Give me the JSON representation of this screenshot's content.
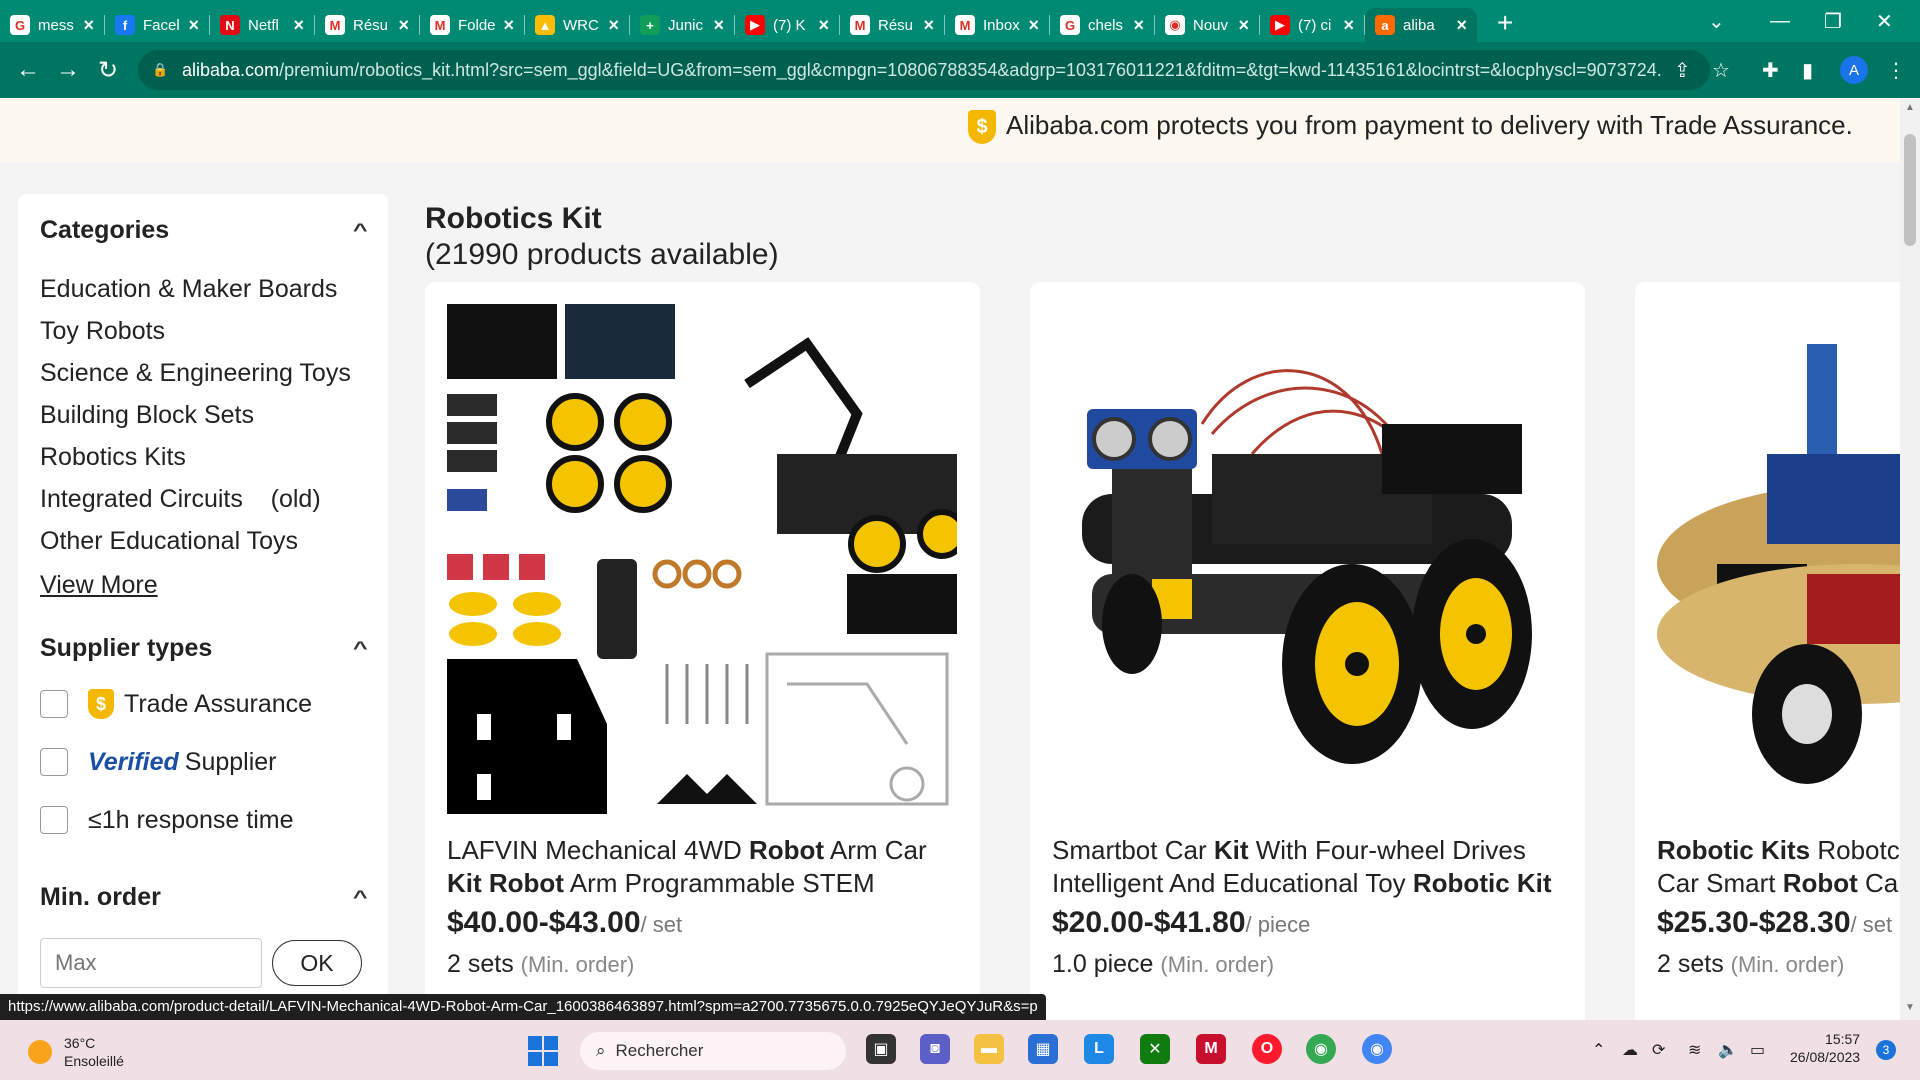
{
  "browser": {
    "tabs": [
      {
        "title": "mess",
        "icon": "google-icon",
        "color": "#ffffff",
        "glyph": "G"
      },
      {
        "title": "Facel",
        "icon": "facebook-icon",
        "color": "#1877f2",
        "glyph": "f"
      },
      {
        "title": "Netfl",
        "icon": "netflix-icon",
        "color": "#e50914",
        "glyph": "N"
      },
      {
        "title": "Résu",
        "icon": "gmail-icon",
        "color": "#ffffff",
        "glyph": "M"
      },
      {
        "title": "Folde",
        "icon": "gmail-icon",
        "color": "#ffffff",
        "glyph": "M"
      },
      {
        "title": "WRC",
        "icon": "drive-icon",
        "color": "#fbbc04",
        "glyph": "▲"
      },
      {
        "title": "Junic",
        "icon": "sheets-icon",
        "color": "#0f9d58",
        "glyph": "+"
      },
      {
        "title": "(7) K",
        "icon": "youtube-icon",
        "color": "#ff0000",
        "glyph": "▶"
      },
      {
        "title": "Résu",
        "icon": "gmail-icon",
        "color": "#ffffff",
        "glyph": "M"
      },
      {
        "title": "Inbox",
        "icon": "gmail-icon",
        "color": "#ffffff",
        "glyph": "M"
      },
      {
        "title": "chels",
        "icon": "google-icon",
        "color": "#ffffff",
        "glyph": "G"
      },
      {
        "title": "Nouv",
        "icon": "chrome-icon",
        "color": "#ffffff",
        "glyph": "◉"
      },
      {
        "title": "(7) ci",
        "icon": "youtube-icon",
        "color": "#ff0000",
        "glyph": "▶"
      },
      {
        "title": "aliba",
        "icon": "alibaba-icon",
        "color": "#ff6a00",
        "glyph": "a"
      }
    ],
    "active_tab": 13,
    "url_host": "alibaba.com",
    "url_rest": "/premium/robotics_kit.html?src=sem_ggl&field=UG&from=sem_ggl&cmpgn=10806788354&adgrp=103176011221&fditm=&tgt=kwd-11435161&locintrst=&locphyscl=9073724...",
    "profile_initial": "A",
    "status_url": "https://www.alibaba.com/product-detail/LAFVIN-Mechanical-4WD-Robot-Arm-Car_1600386463897.html?spm=a2700.7735675.0.0.7925eQYJeQYJuR&s=p"
  },
  "banner": {
    "shield_glyph": "$",
    "message": "Alibaba.com protects you from payment to delivery with Trade Assurance."
  },
  "sidebar": {
    "categories_title": "Categories",
    "categories": [
      "Education & Maker Boards",
      "Toy Robots",
      "Science & Engineering Toys",
      "Building Block Sets",
      "Robotics Kits",
      "Integrated Circuits    (old)",
      "Other Educational Toys"
    ],
    "view_more": "View More",
    "supplier_title": "Supplier types",
    "supplier_options": {
      "trade_assurance": "Trade Assurance",
      "verified_badge": "Verified",
      "verified_label": "Supplier",
      "response_time": "≤1h response time"
    },
    "min_order_title": "Min. order",
    "min_order_placeholder": "Max",
    "ok_label": "OK"
  },
  "results": {
    "title": "Robotics Kit",
    "count": "(21990 products available)"
  },
  "products": [
    {
      "title_line1": [
        "LAFVIN Mechanical 4WD ",
        "Robot",
        " Arm Car"
      ],
      "title_line2": [
        "Kit Robot",
        " Arm Programmable STEM"
      ],
      "price": "$40.00-$43.00",
      "unit": "/ set",
      "moq_value": "2 sets",
      "moq_label": "(Min. order)"
    },
    {
      "title_line1": [
        "Smartbot Car ",
        "Kit",
        " With Four-wheel Drives"
      ],
      "title_line2": [
        "Intelligent And Educational Toy ",
        "Robotic Kit",
        ""
      ],
      "price": "$20.00-$41.80",
      "unit": "/ piece",
      "moq_value": "1.0 piece",
      "moq_label": "(Min. order)"
    },
    {
      "title_line1": [
        "",
        "Robotic Kits",
        " Robotc"
      ],
      "title_line2": [
        "Car Smart ",
        "Robot",
        " Ca"
      ],
      "price": "$25.30-$28.30",
      "unit": "/ set",
      "moq_value": "2 sets",
      "moq_label": "(Min. order)"
    }
  ],
  "taskbar": {
    "temperature": "36°C",
    "weather": "Ensoleillé",
    "search_placeholder": "Rechercher",
    "time": "15:57",
    "date": "26/08/2023",
    "notification_count": "3"
  },
  "colors": {
    "tab_bar": "#008a73",
    "toolbar": "#007561",
    "trade_assurance": "#f5b800",
    "taskbar": "#f1dfe6"
  }
}
